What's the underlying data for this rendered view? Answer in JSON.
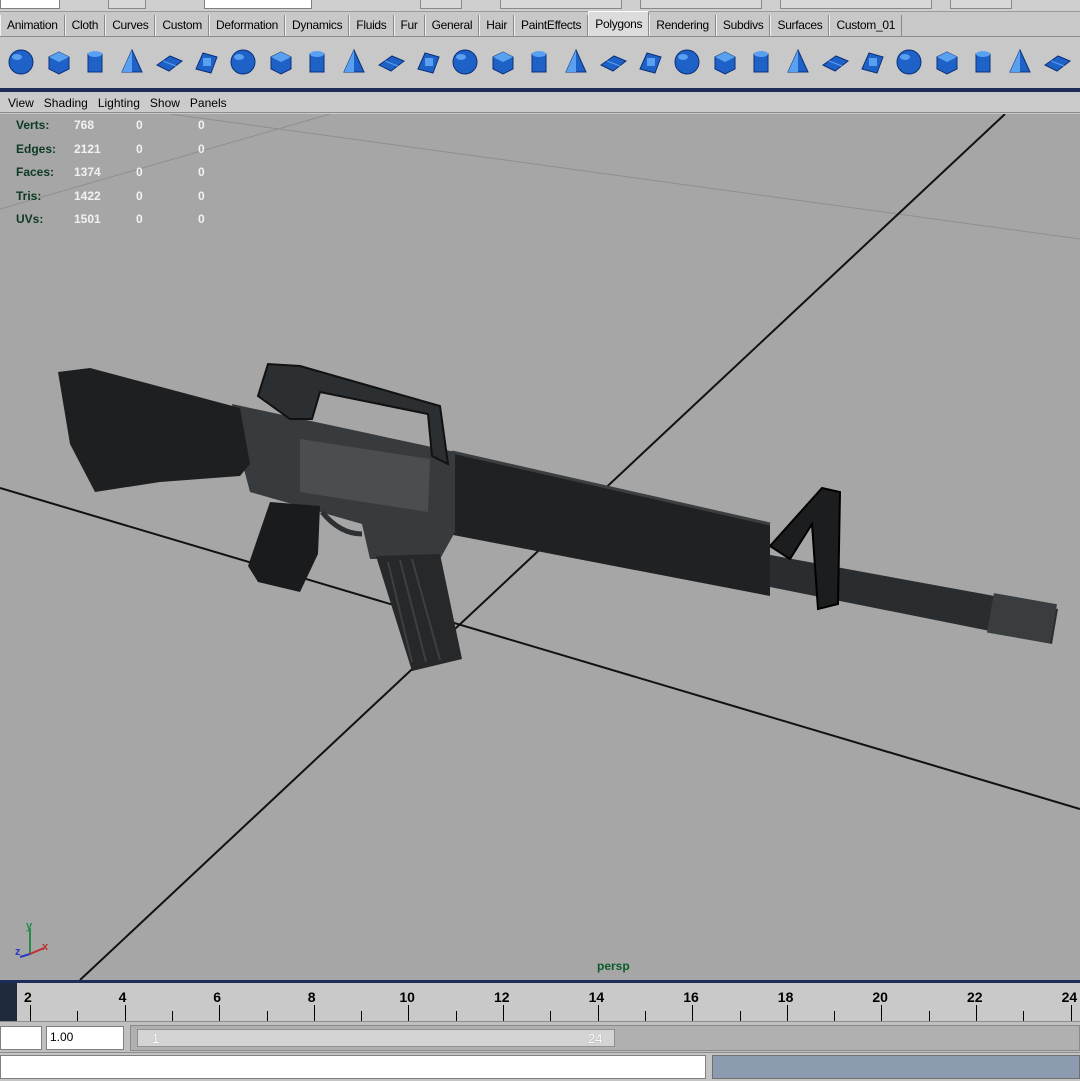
{
  "shelf": {
    "tabs": [
      "Animation",
      "Cloth",
      "Curves",
      "Custom",
      "Deformation",
      "Dynamics",
      "Fluids",
      "Fur",
      "General",
      "Hair",
      "PaintEffects",
      "Polygons",
      "Rendering",
      "Subdivs",
      "Surfaces",
      "Custom_01"
    ],
    "active_tab": "Polygons",
    "icons": [
      "poly-sphere-icon",
      "poly-cube-icon",
      "poly-cylinder-icon",
      "poly-cone-icon",
      "poly-plane-icon",
      "poly-torus-icon",
      "poly-combine-icon",
      "separate-icon",
      "extract-icon",
      "boolean-icon",
      "smooth-icon",
      "average-vertices-icon",
      "extrude-face-icon",
      "split-polygon-icon",
      "wedge-face-icon",
      "duplicate-face-icon",
      "bevel-icon",
      "merge-vertices-icon",
      "collapse-icon",
      "append-polygon-icon",
      "fill-hole-icon",
      "cut-faces-icon",
      "subdivide-icon",
      "triangulate-icon",
      "quadrangulate-icon",
      "planar-mapping-icon",
      "cylindrical-mapping-icon",
      "spherical-mapping-icon",
      "automatic-mapping-icon"
    ]
  },
  "panel_menu": [
    "View",
    "Shading",
    "Lighting",
    "Show",
    "Panels"
  ],
  "heads_up": {
    "rows": [
      {
        "label": "Verts:",
        "value": "768",
        "sel": "0",
        "uv": "0"
      },
      {
        "label": "Edges:",
        "value": "2121",
        "sel": "0",
        "uv": "0"
      },
      {
        "label": "Faces:",
        "value": "1374",
        "sel": "0",
        "uv": "0"
      },
      {
        "label": "Tris:",
        "value": "1422",
        "sel": "0",
        "uv": "0"
      },
      {
        "label": "UVs:",
        "value": "1501",
        "sel": "0",
        "uv": "0"
      }
    ]
  },
  "viewport": {
    "camera": "persp",
    "axis_x": "x",
    "axis_y": "y",
    "axis_z": "z"
  },
  "timeline": {
    "ticks": [
      "2",
      "4",
      "6",
      "8",
      "10",
      "12",
      "14",
      "16",
      "18",
      "20",
      "22",
      "24"
    ]
  },
  "range": {
    "current_time": "1.00",
    "range_start": "1",
    "range_end": "24"
  },
  "colors": {
    "accent": "#1d2d57",
    "viewport_bg": "#a6a6a6",
    "hud_label": "#0d3a22",
    "camera_label": "#0a5c2a"
  }
}
